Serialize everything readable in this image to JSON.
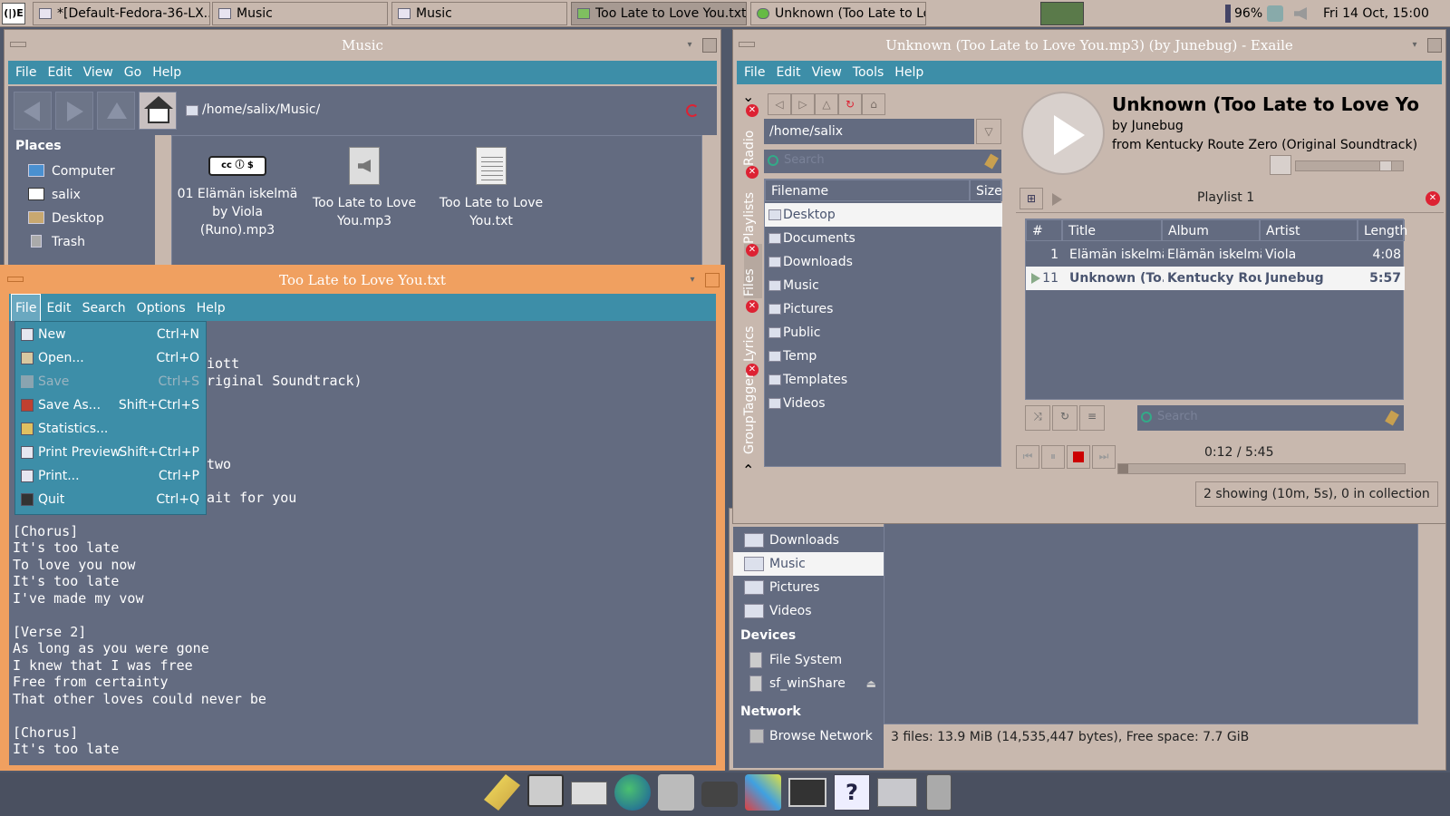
{
  "taskbar": {
    "start_label": "(|)E",
    "tasks": [
      {
        "label": "*[Default-Fedora-36-LX..."
      },
      {
        "label": "Music"
      },
      {
        "label": "Music"
      },
      {
        "label": "Too Late to Love You.txt"
      },
      {
        "label": "Unknown (Too Late to Lo..."
      }
    ],
    "battery": "96%",
    "clock": "Fri 14 Oct, 15:00"
  },
  "file_manager": {
    "title": "Music",
    "menu": [
      "File",
      "Edit",
      "View",
      "Go",
      "Help"
    ],
    "path": "/home/salix/Music/",
    "places_heading": "Places",
    "places": [
      "Computer",
      "salix",
      "Desktop",
      "Trash"
    ],
    "files": [
      {
        "name_line1": "01 Elämän iskelmä",
        "name_line2": "by Viola (Runo).mp3",
        "icon": "cc-license-icon"
      },
      {
        "name_line1": "Too Late to Love",
        "name_line2": "You.mp3",
        "icon": "audio-file-icon"
      },
      {
        "name_line1": "Too Late to Love",
        "name_line2": "You.txt",
        "icon": "text-file-icon"
      }
    ]
  },
  "file_manager2": {
    "side_items": [
      "Downloads",
      "Music",
      "Pictures",
      "Videos"
    ],
    "devices_heading": "Devices",
    "devices": [
      "File System",
      "sf_winShare"
    ],
    "network_heading": "Network",
    "network": [
      "Browse Network"
    ],
    "status": "3 files: 13.9 MiB (14,535,447 bytes), Free space: 7.7 GiB"
  },
  "editor": {
    "title": "Too Late to Love You.txt",
    "menu": [
      "File",
      "Edit",
      "Search",
      "Options",
      "Help"
    ],
    "file_menu": [
      {
        "label": "New",
        "shortcut": "Ctrl+N",
        "disabled": false
      },
      {
        "label": "Open...",
        "shortcut": "Ctrl+O",
        "disabled": false
      },
      {
        "label": "Save",
        "shortcut": "Ctrl+S",
        "disabled": true
      },
      {
        "label": "Save As...",
        "shortcut": "Shift+Ctrl+S",
        "disabled": false
      },
      {
        "label": "Statistics...",
        "shortcut": "",
        "disabled": false
      },
      {
        "label": "Print Preview",
        "shortcut": "Shift+Ctrl+P",
        "disabled": false
      },
      {
        "label": "Print...",
        "shortcut": "Ctrl+P",
        "disabled": false
      },
      {
        "label": "Quit",
        "shortcut": "Ctrl+Q",
        "disabled": false
      }
    ],
    "visible_fragments": [
      "iott",
      "riginal Soundtrack)",
      "two",
      "ait for you"
    ],
    "lines": [
      "[Chorus]",
      "It's too late",
      "To love you now",
      "It's too late",
      "I've made my vow",
      "",
      "[Verse 2]",
      "As long as you were gone",
      "I knew that I was free",
      "Free from certainty",
      "That other loves could never be",
      "",
      "[Chorus]",
      "It's too late"
    ]
  },
  "exaile": {
    "title": "Unknown (Too Late to Love You.mp3) (by Junebug) - Exaile",
    "menu": [
      "File",
      "Edit",
      "View",
      "Tools",
      "Help"
    ],
    "side_tabs": [
      "Radio",
      "Playlists",
      "Files",
      "Lyrics",
      "GroupTagger"
    ],
    "path": "/home/salix",
    "search_placeholder": "Search",
    "file_columns": [
      "Filename",
      "Size"
    ],
    "folders": [
      "Desktop",
      "Documents",
      "Downloads",
      "Music",
      "Pictures",
      "Public",
      "Temp",
      "Templates",
      "Videos"
    ],
    "now_playing": {
      "title": "Unknown (Too Late to Love You....",
      "artist": "by Junebug",
      "album": "from Kentucky Route Zero (Original Soundtrack)"
    },
    "playlist_name": "Playlist 1",
    "playlist_columns": [
      "#",
      "Title",
      "Album",
      "Artist",
      "Length"
    ],
    "playlist": [
      {
        "num": "1",
        "title": "Elämän iskelmä",
        "album": "Elämän iskelmä",
        "artist": "Viola",
        "length": "4:08"
      },
      {
        "num": "11",
        "title": "Unknown (To...",
        "album": "Kentucky Rou...",
        "artist": "Junebug",
        "length": "5:57"
      }
    ],
    "playlist_search_placeholder": "Search",
    "time": "0:12 / 5:45",
    "progress_fraction": 0.035,
    "volume_fraction": 0.88,
    "status": "2 showing (10m, 5s), 0 in collection"
  },
  "colors": {
    "menubar": "#3d8ea8",
    "window_chrome": "#c8b8ae",
    "content_bg": "#636b80",
    "editor_border": "#f0a060"
  }
}
